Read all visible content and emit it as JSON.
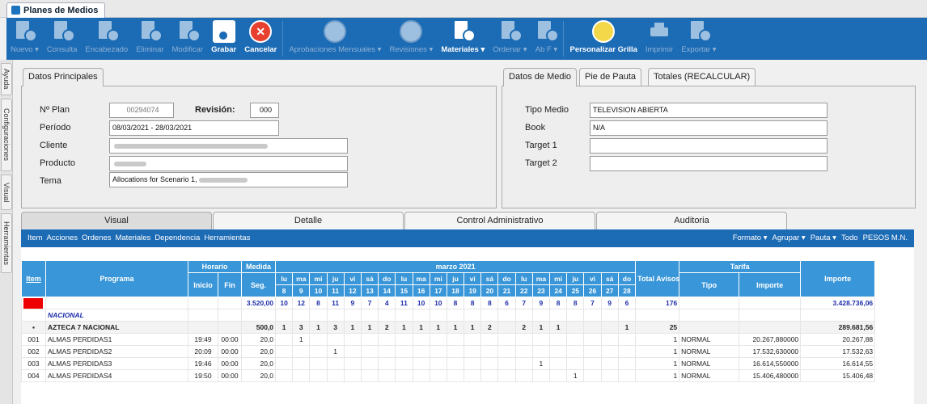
{
  "app": {
    "tab_title": "Planes de Medios"
  },
  "toolbar": {
    "buttons": [
      {
        "label": "Nuevo ▾",
        "icon": "new-doc-icon"
      },
      {
        "label": "Consulta",
        "icon": "consult-doc-icon"
      },
      {
        "label": "Encabezado",
        "icon": "header-edit-icon"
      },
      {
        "label": "Eliminar",
        "icon": "delete-doc-icon"
      },
      {
        "label": "Modificar",
        "icon": "edit-doc-icon"
      },
      {
        "label": "Grabar",
        "icon": "save-icon"
      },
      {
        "label": "Cancelar",
        "icon": "cancel-icon"
      },
      {
        "label": "Aprobaciones Mensuales ▾",
        "icon": "approval-icon"
      },
      {
        "label": "Revisiones ▾",
        "icon": "revisions-icon"
      },
      {
        "label": "Materiales ▾",
        "icon": "materials-icon"
      },
      {
        "label": "Ordenar ▾",
        "icon": "sort-doc-icon"
      },
      {
        "label": "Ab F ▾",
        "icon": "abf-doc-icon"
      },
      {
        "label": "Personalizar Grilla",
        "icon": "grid-customize-icon"
      },
      {
        "label": "Imprimir",
        "icon": "printer-icon"
      },
      {
        "label": "Exportar ▾",
        "icon": "export-doc-icon"
      }
    ]
  },
  "sidebar": {
    "tabs": [
      "Ayuda",
      "Configuraciones",
      "Visual",
      "Herramientas"
    ]
  },
  "datos_principales": {
    "tab": "Datos Principales",
    "labels": {
      "plan": "Nº Plan",
      "revision": "Revisión:",
      "periodo": "Período",
      "cliente": "Cliente",
      "producto": "Producto",
      "tema": "Tema"
    },
    "values": {
      "plan": "00294074",
      "revision": "000",
      "periodo": "08/03/2021 - 28/03/2021",
      "tema": "Allocations for Scenario 1,"
    }
  },
  "datos_medio": {
    "tabs": [
      "Datos de Medio",
      "Pie de Pauta",
      "Totales (RECALCULAR)"
    ],
    "labels": {
      "tipo_medio": "Tipo Medio",
      "book": "Book",
      "target1": "Target 1",
      "target2": "Target 2"
    },
    "values": {
      "tipo_medio": "TELEVISION ABIERTA",
      "book": "N/A",
      "target1": "",
      "target2": ""
    }
  },
  "bottom_tabs": [
    "Visual",
    "Detalle",
    "Control Administrativo",
    "Auditoria"
  ],
  "gridbar": {
    "menus": [
      "Item",
      "Acciones",
      "Ordenes",
      "Materiales",
      "Dependencia",
      "Herramientas"
    ],
    "right": [
      "Formato ▾",
      "Agrupar ▾",
      "Pauta ▾",
      "Todo",
      "PESOS M.N."
    ]
  },
  "grid": {
    "headers": {
      "item": "Item",
      "programa": "Programa",
      "horario": "Horario",
      "inicio": "Inicio",
      "fin": "Fin",
      "medida": "Medida",
      "seg": "Seg.",
      "mes": "marzo 2021",
      "total_avisos": "Total Avisos",
      "tarifa": "Tarifa",
      "tipo": "Tipo",
      "importe": "Importe",
      "importe_total": "Importe"
    },
    "day_names": [
      "lu",
      "ma",
      "mi",
      "ju",
      "vi",
      "sá",
      "do",
      "lu",
      "ma",
      "mi",
      "ju",
      "vi",
      "sá",
      "do",
      "lu",
      "ma",
      "mi",
      "ju",
      "vi",
      "sá",
      "do"
    ],
    "day_numbers": [
      "8",
      "9",
      "10",
      "11",
      "12",
      "13",
      "14",
      "15",
      "16",
      "17",
      "18",
      "19",
      "20",
      "21",
      "22",
      "23",
      "24",
      "25",
      "26",
      "27",
      "28"
    ],
    "weekend_idx": [
      5,
      6,
      12,
      13,
      19,
      20
    ],
    "totals": {
      "seg": "3.520,00",
      "days": [
        "10",
        "12",
        "8",
        "11",
        "9",
        "7",
        "4",
        "11",
        "10",
        "10",
        "8",
        "8",
        "8",
        "6",
        "7",
        "9",
        "8",
        "8",
        "7",
        "9",
        "6"
      ],
      "avisos": "176",
      "importe": "3.428.736,06"
    },
    "sections": [
      {
        "label": "NACIONAL"
      }
    ],
    "groups": [
      {
        "toggle": "▪",
        "name": "AZTECA 7 NACIONAL",
        "seg": "500,0",
        "days": [
          "1",
          "3",
          "1",
          "3",
          "1",
          "1",
          "2",
          "1",
          "1",
          "1",
          "1",
          "1",
          "2",
          "",
          "2",
          "1",
          "1",
          "",
          "",
          "",
          "1"
        ],
        "avisos": "25",
        "importe": "289.681,56"
      }
    ],
    "rows": [
      {
        "item": "001",
        "programa": "ALMAS PERDIDAS1",
        "inicio": "19:49",
        "fin": "00:00",
        "seg": "20,0",
        "days": [
          "",
          "1",
          "",
          "",
          "",
          "",
          "",
          "",
          "",
          "",
          "",
          "",
          "",
          "",
          "",
          "",
          "",
          "",
          "",
          "",
          ""
        ],
        "avisos": "1",
        "tipo": "NORMAL",
        "tarifa_importe": "20.267,880000",
        "importe": "20.267,88"
      },
      {
        "item": "002",
        "programa": "ALMAS PERDIDAS2",
        "inicio": "20:09",
        "fin": "00:00",
        "seg": "20,0",
        "days": [
          "",
          "",
          "",
          "1",
          "",
          "",
          "",
          "",
          "",
          "",
          "",
          "",
          "",
          "",
          "",
          "",
          "",
          "",
          "",
          "",
          ""
        ],
        "avisos": "1",
        "tipo": "NORMAL",
        "tarifa_importe": "17.532,630000",
        "importe": "17.532,63"
      },
      {
        "item": "003",
        "programa": "ALMAS PERDIDAS3",
        "inicio": "19:46",
        "fin": "00:00",
        "seg": "20,0",
        "days": [
          "",
          "",
          "",
          "",
          "",
          "",
          "",
          "",
          "",
          "",
          "",
          "",
          "",
          "",
          "",
          "1",
          "",
          "",
          "",
          "",
          ""
        ],
        "avisos": "1",
        "tipo": "NORMAL",
        "tarifa_importe": "16.614,550000",
        "importe": "16.614,55"
      },
      {
        "item": "004",
        "programa": "ALMAS PERDIDAS4",
        "inicio": "19:50",
        "fin": "00:00",
        "seg": "20,0",
        "days": [
          "",
          "",
          "",
          "",
          "",
          "",
          "",
          "",
          "",
          "",
          "",
          "",
          "",
          "",
          "",
          "",
          "",
          "1",
          "",
          "",
          ""
        ],
        "avisos": "1",
        "tipo": "NORMAL",
        "tarifa_importe": "15.406,480000",
        "importe": "15.406,48"
      }
    ]
  }
}
